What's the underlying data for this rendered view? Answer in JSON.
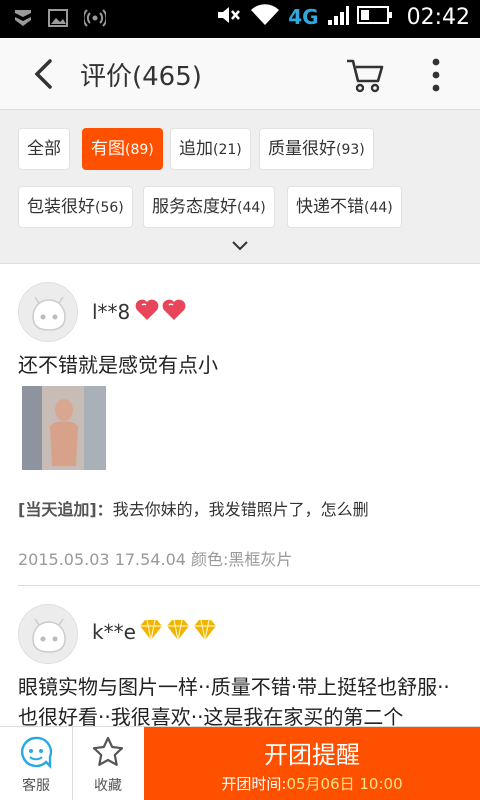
{
  "status_bar": {
    "network": "4G",
    "time": "02:42"
  },
  "header": {
    "title": "评价(465)",
    "icons": [
      "back-icon",
      "cart-icon",
      "more-vertical-icon"
    ]
  },
  "filters": [
    {
      "label": "全部",
      "count": "",
      "active": false
    },
    {
      "label": "有图",
      "count": "(89)",
      "active": true
    },
    {
      "label": "追加",
      "count": "(21)",
      "active": false
    },
    {
      "label": "质量很好",
      "count": "(93)",
      "active": false
    },
    {
      "label": "包装很好",
      "count": "(56)",
      "active": false
    },
    {
      "label": "服务态度好",
      "count": "(44)",
      "active": false
    },
    {
      "label": "快递不错",
      "count": "(44)",
      "active": false
    }
  ],
  "reviews": [
    {
      "user": "l**8",
      "badge": "heart",
      "text": "还不错就是感觉有点小",
      "append_label": "[当天追加]：",
      "append_text": "我去你妹的，我发错照片了，怎么删",
      "meta": "2015.05.03 17.54.04 颜色:黑框灰片"
    },
    {
      "user": "k**e",
      "badge": "diamond",
      "text": "眼镜实物与图片一样··质量不错·带上挺轻也舒服··也很好看··我很喜欢··这是我在家买的第二个"
    }
  ],
  "bottom_bar": {
    "service_label": "客服",
    "favorite_label": "收藏",
    "group_button": "开团提醒",
    "group_time_label": "开团时间:",
    "group_time_value": "05月06日 10:00"
  },
  "colors": {
    "accent": "#ff5000",
    "badge_heart": "#e8455a",
    "badge_diamond": "#f3b400"
  }
}
